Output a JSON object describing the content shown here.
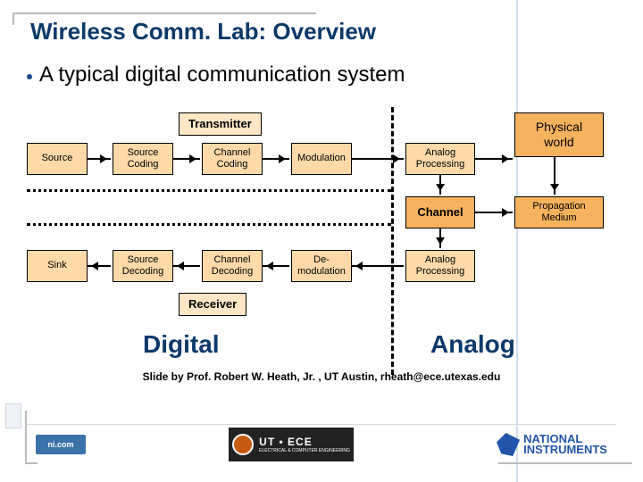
{
  "title": "Wireless Comm. Lab: Overview",
  "bullet": "A typical digital communication system",
  "labels": {
    "transmitter": "Transmitter",
    "receiver": "Receiver",
    "physical_world": "Physical world",
    "propagation_medium": "Propagation Medium",
    "channel": "Channel"
  },
  "tx_chain": {
    "source": "Source",
    "source_coding": "Source Coding",
    "channel_coding": "Channel Coding",
    "modulation": "Modulation",
    "analog_processing": "Analog Processing"
  },
  "rx_chain": {
    "sink": "Sink",
    "source_decoding": "Source Decoding",
    "channel_decoding": "Channel Decoding",
    "demodulation": "De-modulation",
    "analog_processing": "Analog Processing"
  },
  "domains": {
    "digital": "Digital",
    "analog": "Analog"
  },
  "credit": "Slide by Prof. Robert W. Heath, Jr. , UT Austin, rheath@ece.utexas.edu",
  "logos": {
    "ni_small": "ni.com",
    "ut_dept": "UT • ECE",
    "ut_sub": "ELECTRICAL & COMPUTER ENGINEERING",
    "ni_big_line1": "NATIONAL",
    "ni_big_line2": "INSTRUMENTS"
  }
}
